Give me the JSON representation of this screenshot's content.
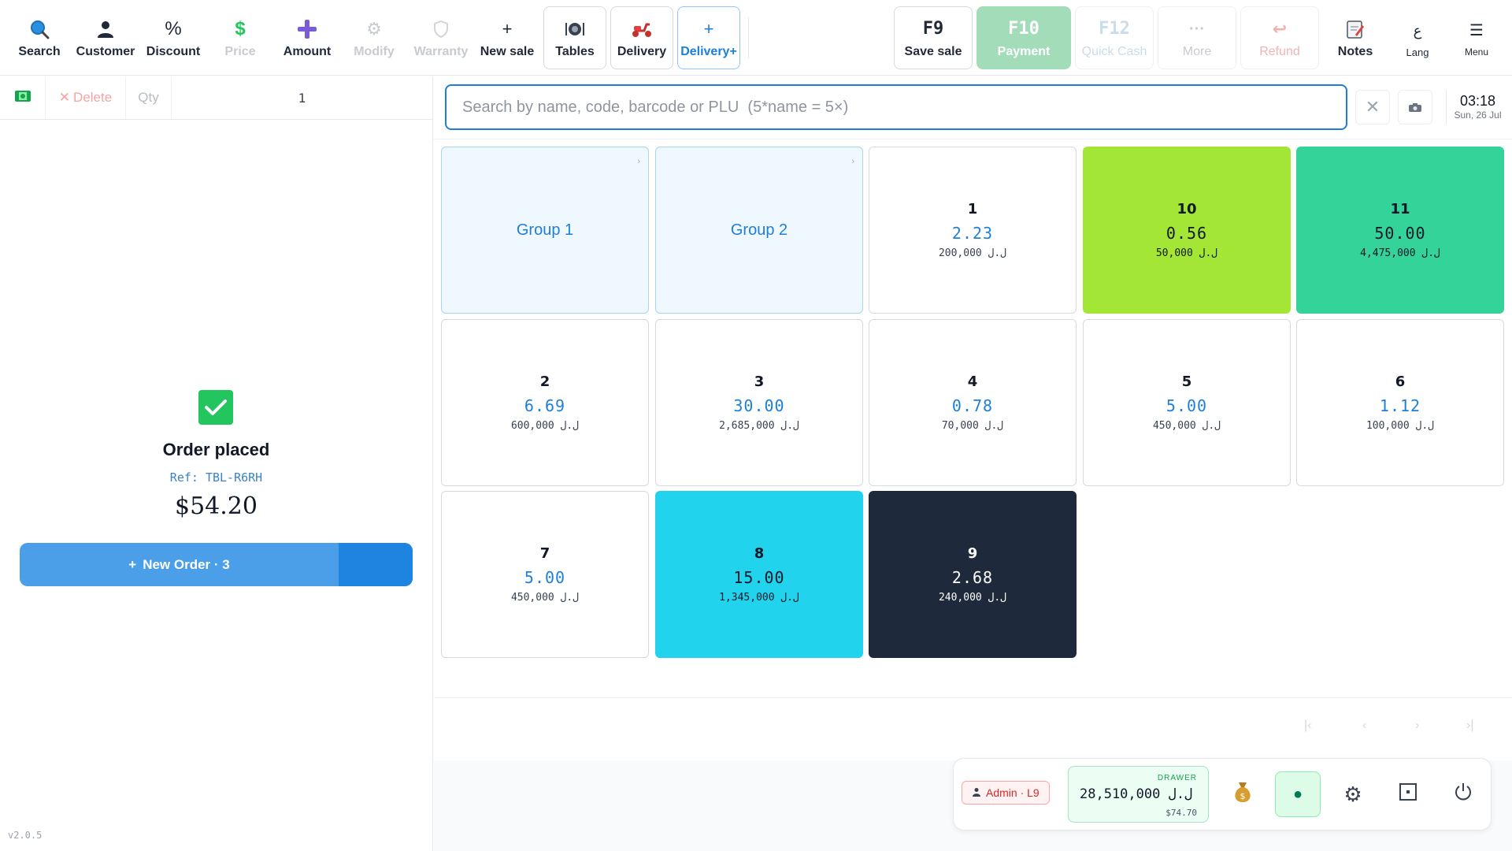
{
  "toolbar": {
    "search": "Search",
    "customer": "Customer",
    "discount": "Discount",
    "price": "Price",
    "amount": "Amount",
    "modify": "Modify",
    "warranty": "Warranty",
    "new_sale": "New sale",
    "tables": "Tables",
    "delivery": "Delivery",
    "delivery_plus": "Delivery+",
    "save_key": "F9",
    "save_sale": "Save sale",
    "payment_key": "F10",
    "payment": "Payment",
    "quick_key": "F12",
    "quick_cash": "Quick Cash",
    "more_icon": "···",
    "more": "More",
    "refund": "Refund",
    "notes": "Notes",
    "lang_icon": "ع",
    "lang": "Lang",
    "menu": "Menu"
  },
  "line_bar": {
    "delete": "Delete",
    "qty": "Qty",
    "qty_value": "1"
  },
  "order": {
    "title": "Order placed",
    "ref": "Ref: TBL-R6RH",
    "total": "$54.20",
    "new_order": "New Order · 3"
  },
  "version": "v2.0.5",
  "search": {
    "placeholder": "Search by name, code, barcode or PLU  (5*name = 5×)"
  },
  "clock": {
    "time": "03:18",
    "date": "Sun, 26 Jul"
  },
  "groups": [
    {
      "name": "Group 1"
    },
    {
      "name": "Group 2"
    }
  ],
  "products": [
    {
      "num": "1",
      "usd": "2.23",
      "lbp": "200,000 ل.ل"
    },
    {
      "num": "10",
      "usd": "0.56",
      "lbp": "50,000 ل.ل"
    },
    {
      "num": "11",
      "usd": "50.00",
      "lbp": "4,475,000 ل.ل"
    },
    {
      "num": "2",
      "usd": "6.69",
      "lbp": "600,000 ل.ل"
    },
    {
      "num": "3",
      "usd": "30.00",
      "lbp": "2,685,000 ل.ل"
    },
    {
      "num": "4",
      "usd": "0.78",
      "lbp": "70,000 ل.ل"
    },
    {
      "num": "5",
      "usd": "5.00",
      "lbp": "450,000 ل.ل"
    },
    {
      "num": "6",
      "usd": "1.12",
      "lbp": "100,000 ل.ل"
    },
    {
      "num": "7",
      "usd": "5.00",
      "lbp": "450,000 ل.ل"
    },
    {
      "num": "8",
      "usd": "15.00",
      "lbp": "1,345,000 ل.ل"
    },
    {
      "num": "9",
      "usd": "2.68",
      "lbp": "240,000 ل.ل"
    }
  ],
  "tile_colors": {
    "lime": "#a3e635",
    "emerald": "#34d399",
    "cyan": "#22d3ee",
    "navy": "#1e293b"
  },
  "dock": {
    "admin": "Admin · L9",
    "drawer_caption": "DRAWER",
    "drawer_lbp": "28,510,000 ل.ل",
    "drawer_usd": "$74.70"
  }
}
